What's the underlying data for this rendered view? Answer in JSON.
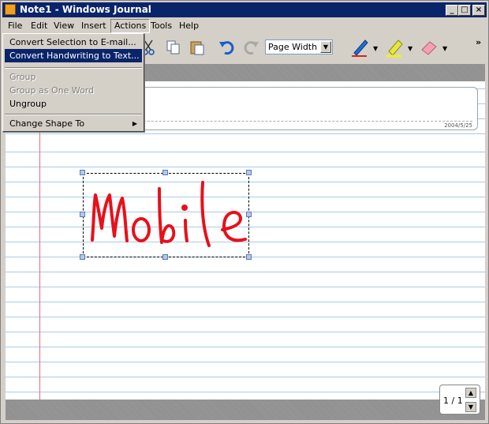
{
  "window": {
    "title": "Note1 - Windows Journal"
  },
  "menubar": {
    "file": "File",
    "edit": "Edit",
    "view": "View",
    "insert": "Insert",
    "actions": "Actions",
    "tools": "Tools",
    "help": "Help"
  },
  "toolbar": {
    "zoom": "Page Width",
    "overflow": "»"
  },
  "actions_menu": {
    "items": [
      {
        "label": "Convert Selection to E-mail..."
      },
      {
        "label": "Convert Handwriting to Text..."
      },
      {
        "label": "Group"
      },
      {
        "label": "Group as One Word"
      },
      {
        "label": "Ungroup"
      },
      {
        "label": "Change Shape To"
      }
    ]
  },
  "note": {
    "date": "2004/5/25",
    "ink_word": "mobile"
  },
  "pager": {
    "label": "1 / 1"
  },
  "colors": {
    "titlebar": "#0a246a",
    "ink": "#e8101a",
    "rule_line": "#a9cbe8",
    "margin_line": "#e46a7a"
  },
  "icons": [
    "app-icon",
    "minimize-icon",
    "maximize-icon",
    "close-icon",
    "cut-icon",
    "copy-icon",
    "paste-icon",
    "undo-icon",
    "redo-icon",
    "pen-icon",
    "highlighter-icon",
    "eraser-icon",
    "chevron-right-icon",
    "page-up-icon",
    "page-down-icon"
  ]
}
